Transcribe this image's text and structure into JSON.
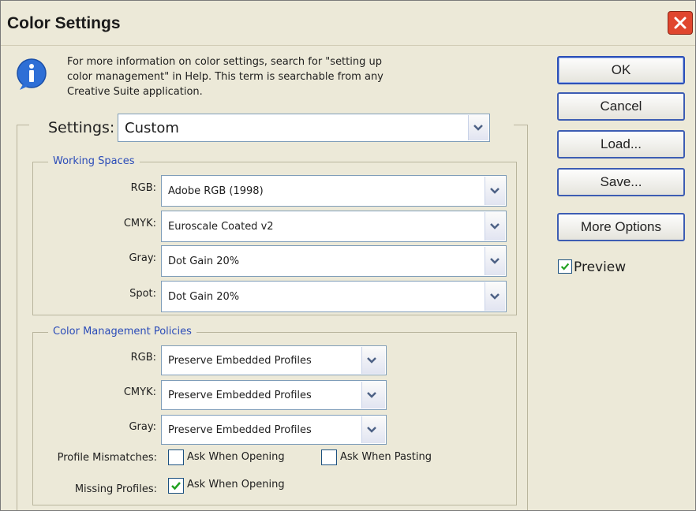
{
  "window": {
    "title": "Color Settings"
  },
  "info": {
    "icon": "info-icon",
    "text_lines": [
      "For more information on color settings, search for \"setting up",
      "color management\" in Help. This term is searchable from any",
      "Creative Suite application."
    ]
  },
  "settings": {
    "label": "Settings:",
    "value": "Custom"
  },
  "working_spaces": {
    "legend": "Working Spaces",
    "rgb_label": "RGB:",
    "rgb_value": "Adobe RGB (1998)",
    "cmyk_label": "CMYK:",
    "cmyk_value": "Euroscale Coated v2",
    "gray_label": "Gray:",
    "gray_value": "Dot Gain 20%",
    "spot_label": "Spot:",
    "spot_value": "Dot Gain 20%"
  },
  "policies": {
    "legend": "Color Management Policies",
    "rgb_label": "RGB:",
    "rgb_value": "Preserve Embedded Profiles",
    "cmyk_label": "CMYK:",
    "cmyk_value": "Preserve Embedded Profiles",
    "gray_label": "Gray:",
    "gray_value": "Preserve Embedded Profiles",
    "mismatch_label": "Profile Mismatches:",
    "mismatch_opening": {
      "label": "Ask When Opening",
      "checked": false
    },
    "mismatch_pasting": {
      "label": "Ask When Pasting",
      "checked": false
    },
    "missing_label": "Missing Profiles:",
    "missing_opening": {
      "label": "Ask When Opening",
      "checked": true
    }
  },
  "buttons": {
    "ok": "OK",
    "cancel": "Cancel",
    "load": "Load...",
    "save": "Save...",
    "more_options": "More Options"
  },
  "preview": {
    "label": "Preview",
    "checked": true
  },
  "colors": {
    "legend_blue": "#2b4cb8",
    "button_border": "#3d5db3",
    "check_green": "#21a121",
    "close_red": "#e0462e",
    "dialog_bg": "#ece9d8"
  }
}
